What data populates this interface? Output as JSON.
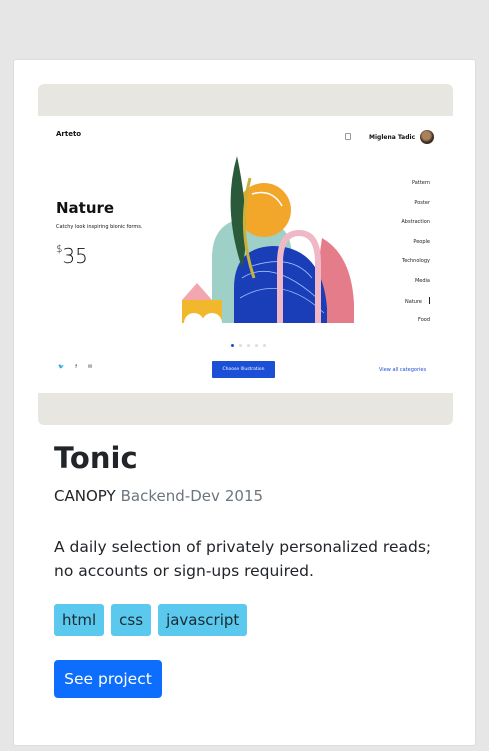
{
  "card": {
    "title": "Tonic",
    "company": "CANOPY",
    "role": "Backend-Dev",
    "year": "2015",
    "description": "A daily selection of privately personalized reads; no accounts or sign-ups required.",
    "tags": [
      "html",
      "css",
      "javascript"
    ],
    "button_label": "See project"
  },
  "preview": {
    "brand": "Arteto",
    "user_name": "Miglena Tadic",
    "heading": "Nature",
    "subtitle": "Catchy look inspiring bionic forms.",
    "price_currency": "$",
    "price_value": "35",
    "categories": [
      "Pattern",
      "Poster",
      "Abstraction",
      "People",
      "Technology",
      "Media",
      "Nature",
      "Food"
    ],
    "active_category_index": 6,
    "social": [
      "twitter-icon",
      "facebook-icon",
      "mail-icon"
    ],
    "cta_label": "Choose Illustration",
    "view_all_label": "View all categories",
    "slider_dots": 5,
    "active_dot": 0
  },
  "colors": {
    "page_bg": "#e6e6e6",
    "card_bg": "#ffffff",
    "tag_bg": "#5bc8ee",
    "button_bg": "#0d6efd",
    "muted_text": "#6c757d",
    "mock_accent": "#1a4fd6"
  }
}
